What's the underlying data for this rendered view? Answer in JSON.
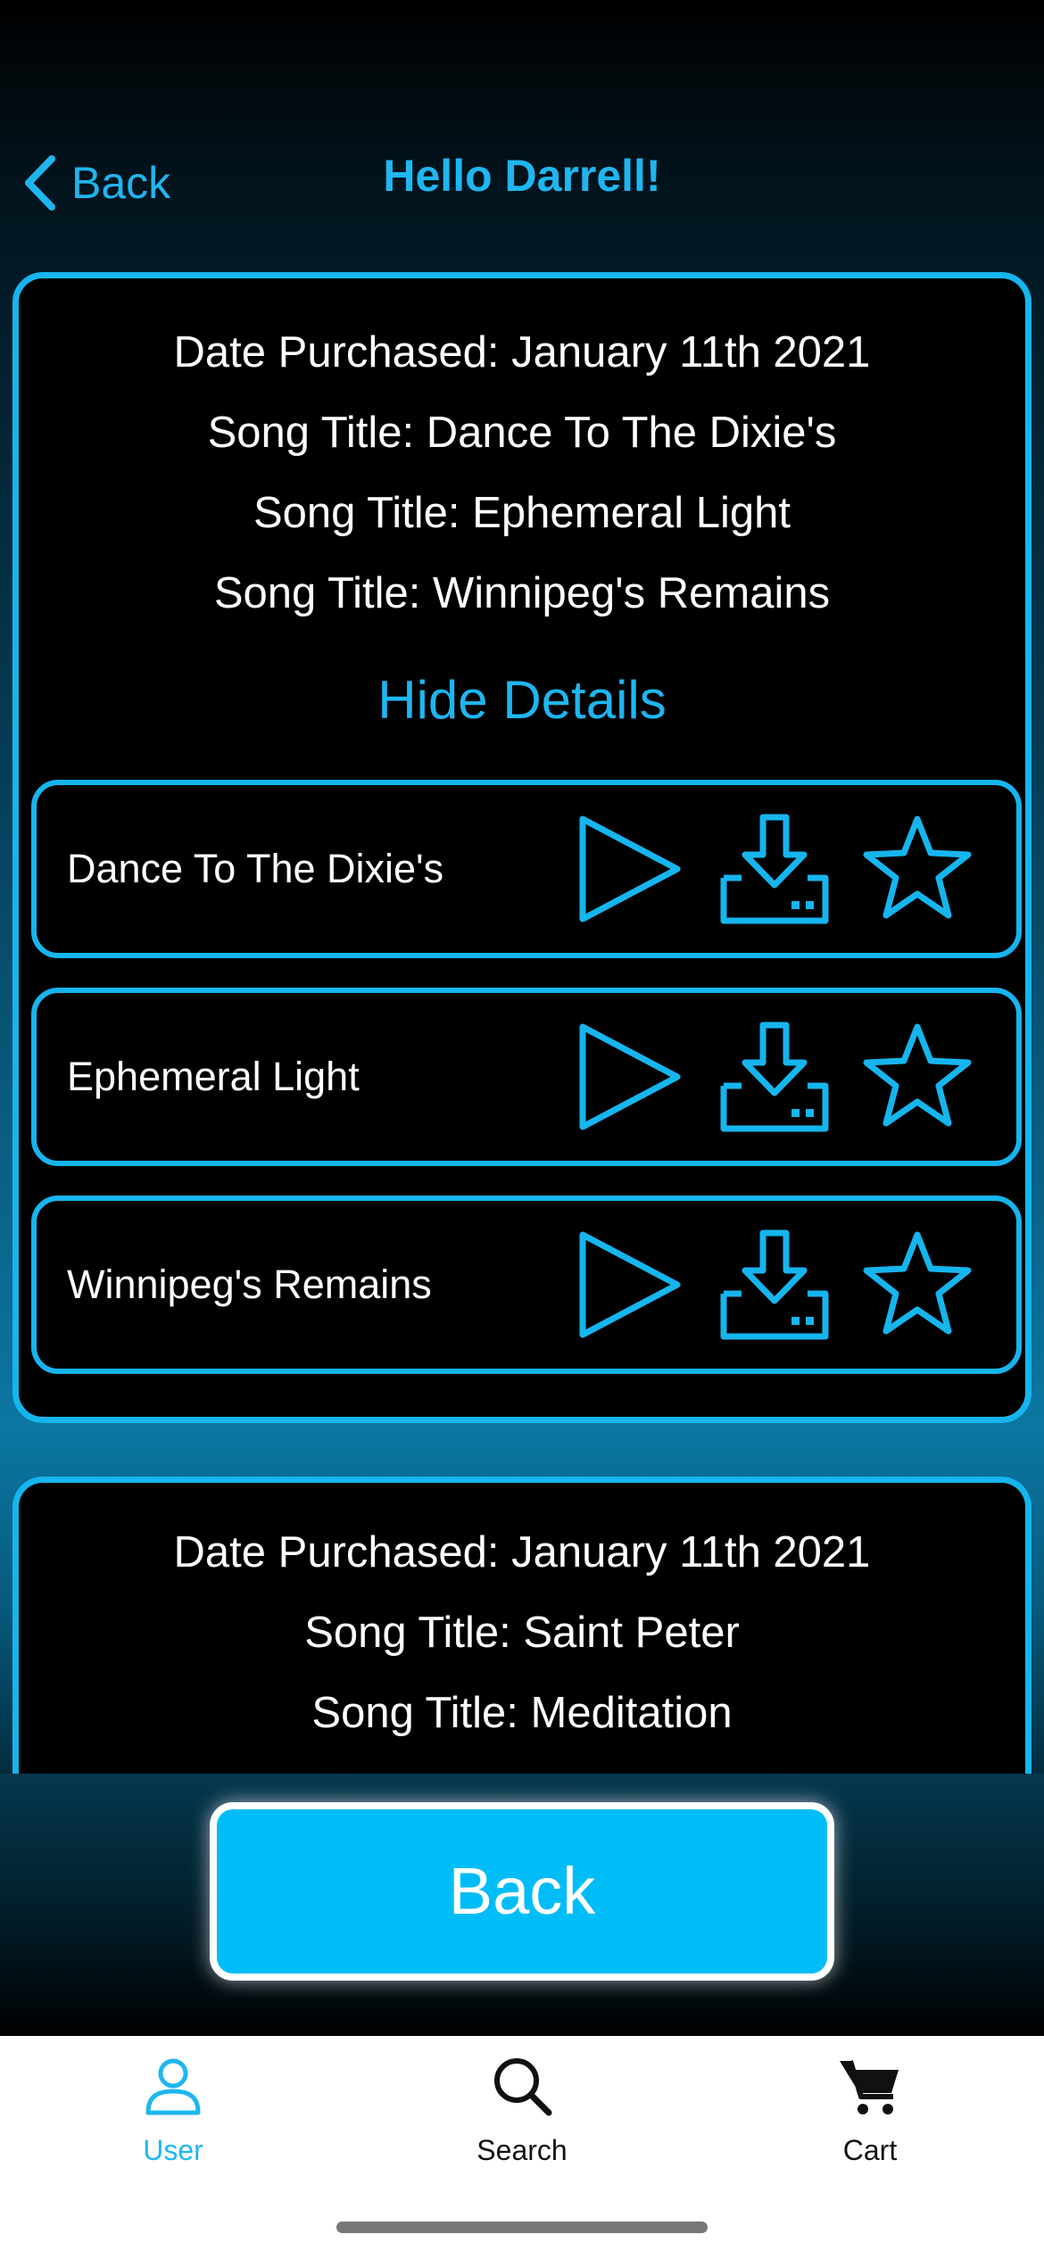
{
  "header": {
    "back_label": "Back",
    "title": "Hello Darrell!"
  },
  "purchases": [
    {
      "date_line": "Date Purchased: January 11th 2021",
      "song_lines": [
        "Song Title: Dance To The Dixie's",
        "Song Title: Ephemeral Light",
        "Song Title: Winnipeg's Remains"
      ],
      "toggle_label": "Hide Details",
      "songs": [
        {
          "name": "Dance To The Dixie's"
        },
        {
          "name": "Ephemeral Light"
        },
        {
          "name": "Winnipeg's Remains"
        }
      ]
    },
    {
      "date_line": "Date Purchased: January 11th 2021",
      "song_lines": [
        "Song Title: Saint Peter",
        "Song Title: Meditation"
      ]
    }
  ],
  "back_button_label": "Back",
  "tabbar": {
    "tabs": [
      {
        "label": "User",
        "icon": "user-icon",
        "active": true
      },
      {
        "label": "Search",
        "icon": "search-icon",
        "active": false
      },
      {
        "label": "Cart",
        "icon": "cart-icon",
        "active": false
      }
    ]
  },
  "colors": {
    "accent": "#1fb6f0",
    "button_fill": "#00bdf8",
    "card_bg": "#000000",
    "tabbar_bg": "#ffffff"
  }
}
